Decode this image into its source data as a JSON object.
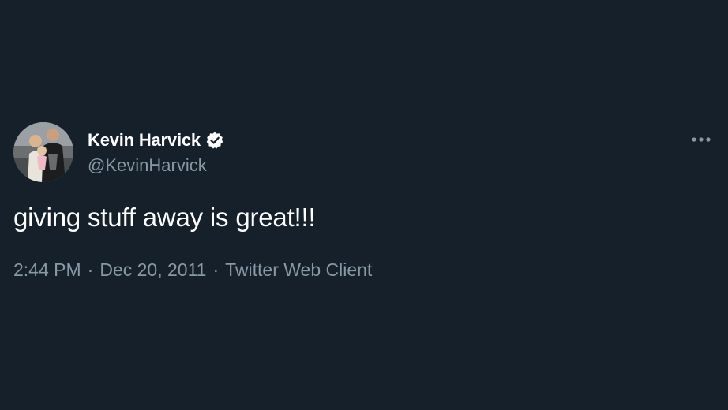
{
  "tweet": {
    "author": {
      "display_name": "Kevin Harvick",
      "handle": "@KevinHarvick",
      "verified": true,
      "avatar_icon": "profile-photo"
    },
    "text": "giving stuff away is great!!!",
    "time": "2:44 PM",
    "date": "Dec 20, 2011",
    "source": "Twitter Web Client",
    "separator": "·",
    "more_icon": "more-dots-icon"
  },
  "colors": {
    "background": "#15202b",
    "primary_text": "#ffffff",
    "secondary_text": "#8899a6"
  }
}
